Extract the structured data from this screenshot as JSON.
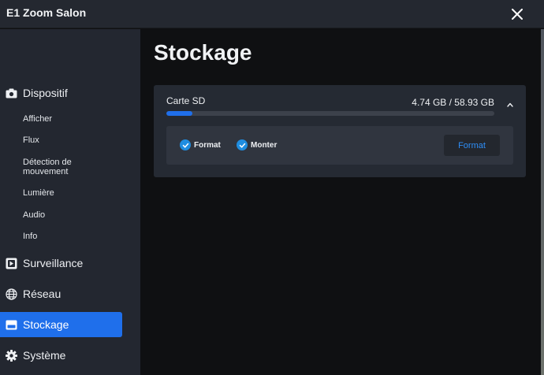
{
  "app": {
    "title": "E1 Zoom Salon"
  },
  "sidebar": {
    "device": {
      "label": "Dispositif",
      "icon": "camera-icon",
      "sub_items": [
        "Afficher",
        "Flux",
        "Détection de mouvement",
        "Lumière",
        "Audio",
        "Info"
      ]
    },
    "items": [
      {
        "label": "Surveillance",
        "icon": "surveillance-icon"
      },
      {
        "label": "Réseau",
        "icon": "globe-icon"
      },
      {
        "label": "Stockage",
        "icon": "storage-icon",
        "active": true
      },
      {
        "label": "Système",
        "icon": "gear-icon"
      }
    ]
  },
  "main": {
    "title": "Stockage",
    "card": {
      "label": "Carte SD",
      "usage": "4.74 GB / 58.93 GB",
      "usage_fraction": 0.08,
      "options": [
        {
          "label": "Format",
          "checked": true
        },
        {
          "label": "Monter",
          "checked": true
        }
      ],
      "format_button": "Format"
    }
  },
  "colors": {
    "accent": "#1f6feb",
    "check": "#1f8de0",
    "button_text": "#2e8ef7",
    "sidebar_bg": "#232730",
    "main_bg": "#0f1012"
  }
}
